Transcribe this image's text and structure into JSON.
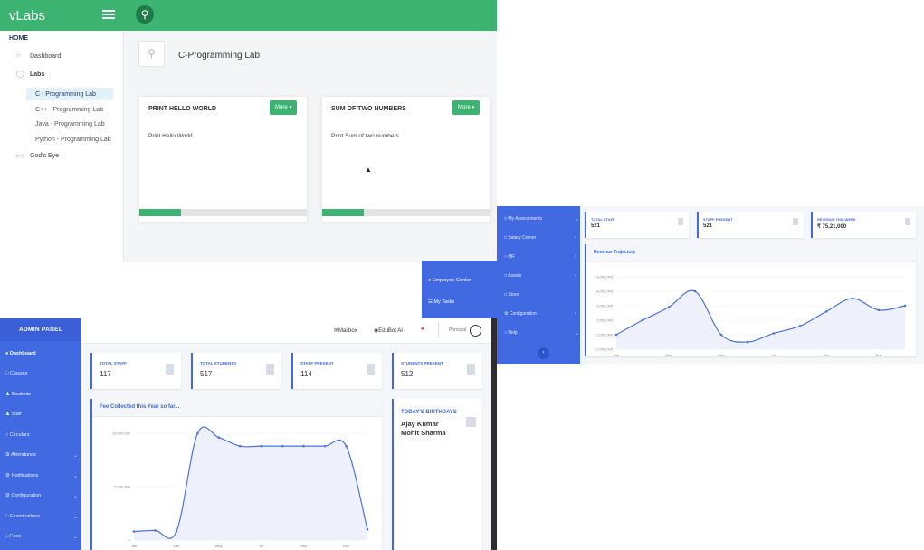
{
  "vlabs": {
    "brand": "vLabs",
    "home": "HOME",
    "nav": [
      {
        "label": "Dashboard"
      },
      {
        "label": "Labs"
      },
      {
        "label": "God's Eye"
      }
    ],
    "sub_items": [
      {
        "label": "C - Programming Lab",
        "active": true
      },
      {
        "label": "C++ - Programming Lab",
        "active": false
      },
      {
        "label": "Java - Programming Lab",
        "active": false
      },
      {
        "label": "Python - Programming Lab",
        "active": false
      }
    ],
    "lab_title": "C-Programming Lab",
    "cards": [
      {
        "title": "PRINT HELLO WORLD",
        "more": "More ▾",
        "desc": "Print Hello World",
        "progress": 0.25
      },
      {
        "title": "SUM OF TWO NUMBERS",
        "more": "More ▾",
        "desc": "Print Sum of two numbers",
        "progress": 0.25
      }
    ],
    "colors": {
      "accent": "#3cb371"
    }
  },
  "panel_a": {
    "sidebar": [
      {
        "label": "My Assessments",
        "chevron": true
      },
      {
        "label": "Salary Corner",
        "chevron": true
      },
      {
        "label": "HR",
        "chevron": true
      },
      {
        "label": "Assets",
        "chevron": true
      },
      {
        "label": "Store",
        "chevron": false
      },
      {
        "label": "Configuration",
        "chevron": true
      },
      {
        "label": "Help",
        "chevron": true
      }
    ],
    "stats": [
      {
        "label": "TOTAL STAFF",
        "value": "521"
      },
      {
        "label": "STAFF PRESENT",
        "value": "521"
      },
      {
        "label": "REVENUE THIS WEEK",
        "value": "₹ 75,21,000"
      }
    ],
    "chart_title": "Revenue Trajectory"
  },
  "employee_strip": {
    "items": [
      "Employee Center",
      "My Tasks"
    ]
  },
  "panel_b": {
    "brand": "ADMIN PANEL",
    "sidebar": [
      {
        "label": "Dashboard",
        "chevron": false,
        "active": true
      },
      {
        "label": "Classes",
        "chevron": false
      },
      {
        "label": "Students",
        "chevron": false
      },
      {
        "label": "Staff",
        "chevron": false
      },
      {
        "label": "Circulars",
        "chevron": false
      },
      {
        "label": "Attendance",
        "chevron": true
      },
      {
        "label": "Notifications",
        "chevron": true
      },
      {
        "label": "Configuration",
        "chevron": true
      },
      {
        "label": "Examinations",
        "chevron": true
      },
      {
        "label": "Fees",
        "chevron": true
      }
    ],
    "topnav": {
      "mailbox": "Mailbox",
      "edubot": "EduBot AI",
      "user": "Principal"
    },
    "stats": [
      {
        "label": "TOTAL STAFF",
        "value": "117"
      },
      {
        "label": "TOTAL STUDENTS",
        "value": "517"
      },
      {
        "label": "STAFF PRESENT",
        "value": "114"
      },
      {
        "label": "STUDENTS PRESENT",
        "value": "512"
      }
    ],
    "chart_title": "Fee Collected this Year so far...",
    "birthdays": {
      "title": "TODAY'S BIRTHDAYS",
      "names": [
        "Ajay Kumar",
        "Mohit Sharma"
      ]
    },
    "colors": {
      "accent": "#4169e1"
    }
  },
  "chart_data": [
    {
      "type": "line",
      "title": "Revenue Trajectory",
      "x_ticks": [
        "Jan",
        "Mar",
        "May",
        "Jul",
        "Sep",
        "Nov"
      ],
      "y_ticks": [
        "0,000,000",
        "1,000,000",
        "2,000,000",
        "3,000,000",
        "4,000,000",
        "5,000,000"
      ],
      "ylim": [
        0,
        5000000
      ],
      "x": [
        0,
        1,
        2,
        3,
        4,
        5,
        6,
        7,
        8,
        9,
        10,
        11
      ],
      "values": [
        1000000,
        2000000,
        2900000,
        4000000,
        1000000,
        500000,
        1100000,
        1600000,
        2600000,
        3500000,
        2700000,
        3000000
      ]
    },
    {
      "type": "line",
      "title": "Fee Collected this Year so far...",
      "x_ticks": [
        "Jan",
        "Mar",
        "May",
        "Jul",
        "Sep",
        "Nov"
      ],
      "y_ticks": [
        "0",
        "5,000,000",
        "10,000,000"
      ],
      "ylim": [
        0,
        10000000
      ],
      "x": [
        0,
        1,
        2,
        3,
        4,
        5,
        6,
        7,
        8,
        9,
        10,
        11
      ],
      "values": [
        800000,
        900000,
        800000,
        10000000,
        9600000,
        8800000,
        8800000,
        8800000,
        8800000,
        8800000,
        8800000,
        1000000
      ]
    }
  ]
}
